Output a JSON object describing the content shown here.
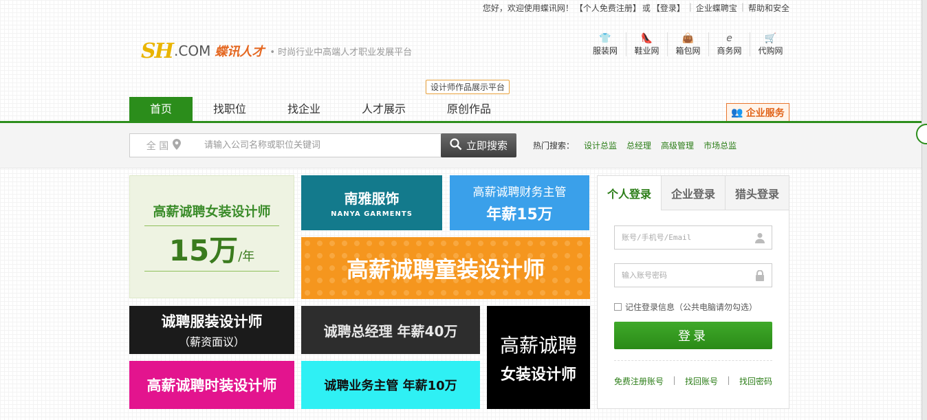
{
  "topbar": {
    "greeting": "您好，欢迎使用蝶讯网！",
    "register": "【个人免费注册】",
    "or": "或",
    "login": "【登录】",
    "enterprise": "企业蝶聘宝",
    "help": "帮助和安全"
  },
  "logo": {
    "mark": "SH",
    "com": ".COM",
    "cn": "蝶讯人才",
    "slogan": "• 时尚行业中高端人才职业发展平台"
  },
  "channels": [
    {
      "icon": "shirt-icon",
      "glyph": "👕",
      "label": "服装网"
    },
    {
      "icon": "shoe-icon",
      "glyph": "👠",
      "label": "鞋业网"
    },
    {
      "icon": "bag-icon",
      "glyph": "👜",
      "label": "箱包网"
    },
    {
      "icon": "e-icon",
      "glyph": "e",
      "label": "商务网"
    },
    {
      "icon": "cart-icon",
      "glyph": "🛒",
      "label": "代购网"
    }
  ],
  "badge_tip": "设计师作品展示平台",
  "nav": [
    "首页",
    "找职位",
    "找企业",
    "人才展示",
    "原创作品"
  ],
  "enterprise_service": "企业服务",
  "search": {
    "city": "全  国",
    "placeholder": "请输入公司名称或职位关键词",
    "button": "立即搜索",
    "hot_label": "热门搜索：",
    "hot": [
      "设计总监",
      "总经理",
      "高级管理",
      "市场总监"
    ]
  },
  "ads": {
    "ad1_line1": "高薪诚聘女装设计师",
    "ad1_big": "15万",
    "ad1_unit": "/年",
    "ad2_title": "南雅服饰",
    "ad2_sub": "NANYA GARMENTS",
    "ad3_title": "高薪诚聘财务主管",
    "ad3_big": "年薪15万",
    "ad4": "高薪诚聘童装设计师",
    "ad5_title": "诚聘服装设计师",
    "ad5_sub": "（薪资面议）",
    "ad6": "诚聘总经理  年薪40万",
    "ad7_title": "高薪诚聘",
    "ad7_sub": "女装设计师",
    "ad8": "高薪诚聘时装设计师",
    "ad9": "诚聘业务主管   年薪10万"
  },
  "login": {
    "tabs": [
      "个人登录",
      "企业登录",
      "猎头登录"
    ],
    "account_placeholder": "账号/手机号/Email",
    "password_placeholder": "输入账号密码",
    "remember": "记住登录信息（公共电脑请勿勾选）",
    "button": "登录",
    "links": [
      "免费注册账号",
      "找回账号",
      "找回密码"
    ]
  },
  "colors": {
    "brand_green": "#2b8d1b",
    "accent_orange": "#e4661f"
  }
}
